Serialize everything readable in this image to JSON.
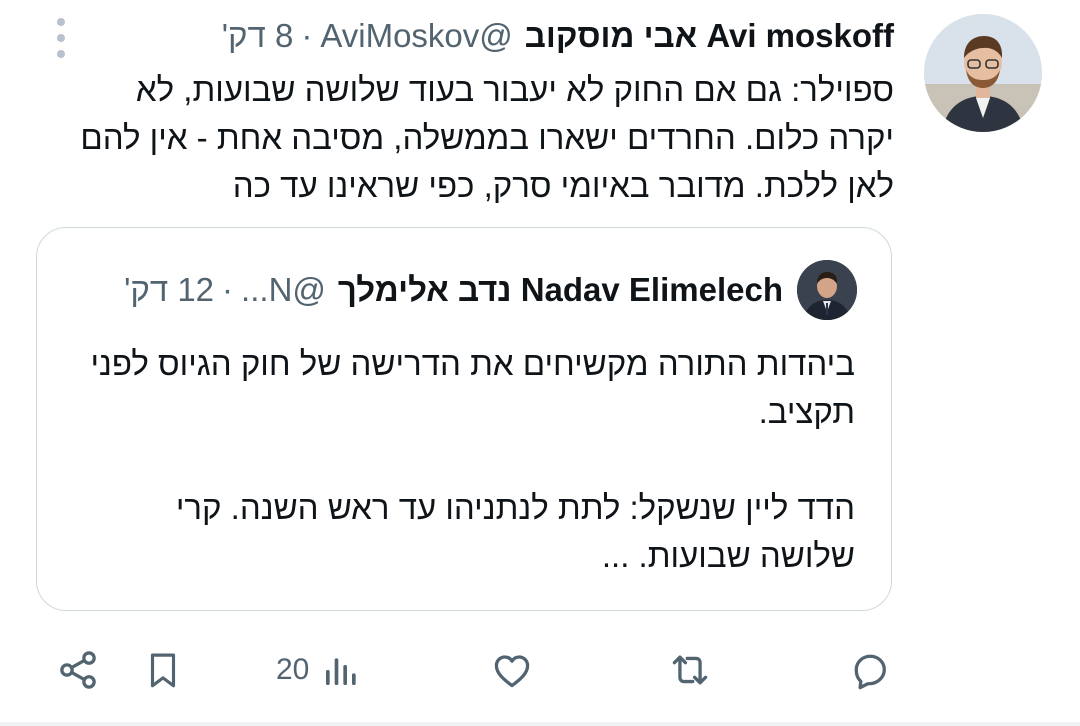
{
  "author": {
    "name": "Avi moskoff אבי מוסקוב",
    "handle": "@AviMoskov",
    "separator": "·",
    "time": "8 דק'"
  },
  "tweet": {
    "text": "ספוילר: גם אם החוק לא יעבור בעוד שלושה שבועות, לא יקרה כלום. החרדים ישארו בממשלה, מסיבה אחת - אין להם לאן ללכת. מדובר באיומי סרק, כפי שראינו עד כה"
  },
  "quote": {
    "name": "Nadav Elimelech נדב אלימלך",
    "handle": "@N...",
    "separator": "·",
    "time": "12 דק'",
    "text": "ביהדות התורה מקשיחים את הדרישה של חוק הגיוס לפני תקציב.\n\nהדד ליין שנשקל: לתת לנתניהו עד ראש השנה. קרי שלושה שבועות. ..."
  },
  "actions": {
    "views_count": "20"
  },
  "icons": [
    "more-icon",
    "reply-icon",
    "retweet-icon",
    "like-icon",
    "views-icon",
    "bookmark-icon",
    "share-icon"
  ],
  "colors": {
    "text": "#0f1419",
    "secondary": "#536471",
    "border": "#cfd9de"
  }
}
